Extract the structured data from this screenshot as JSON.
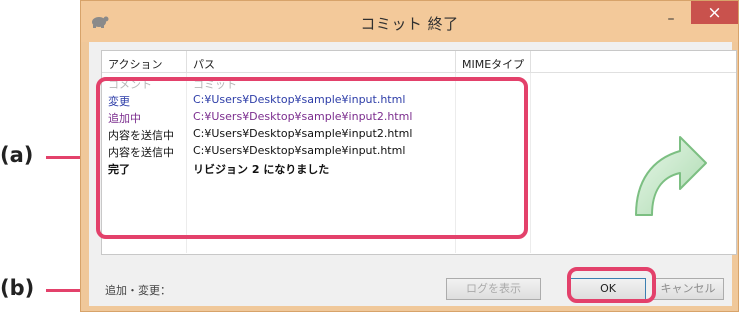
{
  "window": {
    "title": "コミット 終了",
    "app_icon": "tortoise-icon",
    "minimize_glyph": "–",
    "maximize_glyph": "□",
    "close_glyph": "×"
  },
  "list": {
    "headers": {
      "action": "アクション",
      "path": "パス",
      "mime": "MIMEタイプ"
    },
    "rows": [
      {
        "action": "コメント",
        "path": "コミット",
        "color": "#b7b7b7",
        "bold": false
      },
      {
        "action": "変更",
        "path": "C:¥Users¥Desktop¥sample¥input.html",
        "color": "#2d3da8",
        "bold": false
      },
      {
        "action": "追加中",
        "path": "C:¥Users¥Desktop¥sample¥input2.html",
        "color": "#7b2d8e",
        "bold": false
      },
      {
        "action": "内容を送信中",
        "path": "C:¥Users¥Desktop¥sample¥input2.html",
        "color": "#111111",
        "bold": false
      },
      {
        "action": "内容を送信中",
        "path": "C:¥Users¥Desktop¥sample¥input.html",
        "color": "#111111",
        "bold": false
      },
      {
        "action": "完了",
        "path": "リビジョン 2 になりました",
        "color": "#111111",
        "bold": true
      }
    ]
  },
  "status": {
    "text": "追加・変更："
  },
  "buttons": {
    "detail": "ログを表示",
    "ok": "OK",
    "cancel": "キャンセル"
  },
  "annotations": {
    "a": "(a)",
    "b": "(b)"
  },
  "colors": {
    "highlight": "#e3416b",
    "close_button": "#c9524d",
    "titlebar": "#f3c99a"
  }
}
